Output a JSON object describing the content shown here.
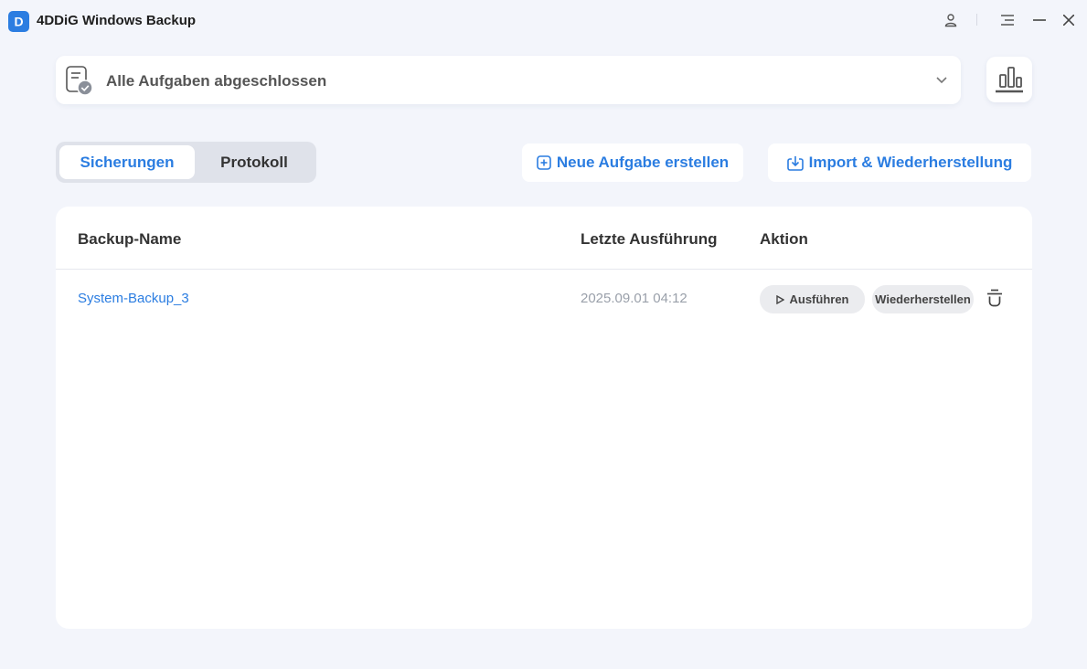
{
  "app": {
    "title": "4DDiG Windows Backup",
    "logo_letter": "D",
    "brand_color": "#2b7de1"
  },
  "window_controls": [
    "user-icon",
    "menu-icon",
    "minimize-icon",
    "close-icon"
  ],
  "status": {
    "text": "Alle Aufgaben abgeschlossen",
    "icon": "task-document-check-icon"
  },
  "tabs": [
    {
      "label": "Sicherungen",
      "active": true
    },
    {
      "label": "Protokoll",
      "active": false
    }
  ],
  "toolbar": {
    "new_task_label": "Neue Aufgabe erstellen",
    "import_label": "Import & Wiederherstellung"
  },
  "table": {
    "columns": [
      "Backup-Name",
      "Letzte Ausführung",
      "Aktion"
    ],
    "rows": [
      {
        "name": "System-Backup_3",
        "last_run": "2025.09.01 04:12",
        "run_label": "Ausführen",
        "restore_label": "Wiederherstellen"
      }
    ]
  }
}
